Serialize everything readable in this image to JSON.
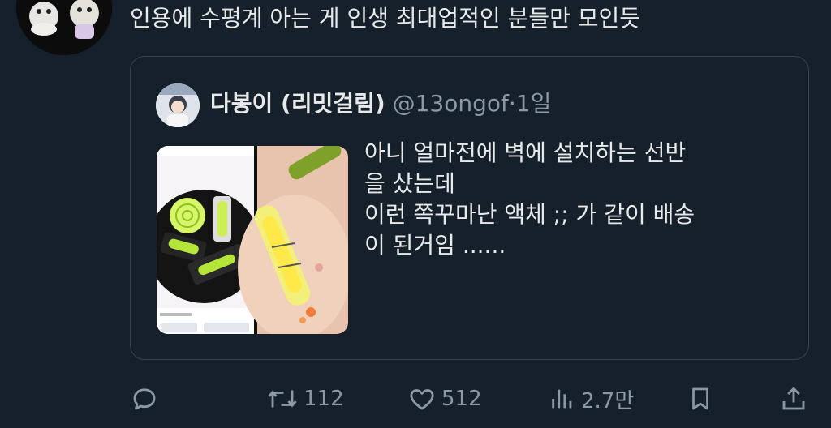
{
  "tweet": {
    "text": "인용에 수평계 아는 게 인생 최대업적인 분들만 모인듯"
  },
  "quote": {
    "name": "다봉이 (리밋걸림)",
    "handle": "@13ongof",
    "separator": "·",
    "time": "1일",
    "lines": [
      "아니 얼마전에 벽에 설치하는 선반",
      "을 샀는데",
      "이런 쪽꾸마난 액체 ;; 가 같이 배송",
      "이 된거임 ......"
    ]
  },
  "actions": {
    "reply": {
      "icon": "reply-icon"
    },
    "retweet": {
      "icon": "retweet-icon",
      "count": "112"
    },
    "like": {
      "icon": "heart-icon",
      "count": "512"
    },
    "views": {
      "icon": "views-icon",
      "count": "2.7만"
    },
    "bookmark": {
      "icon": "bookmark-icon"
    },
    "share": {
      "icon": "share-icon"
    }
  },
  "colors": {
    "background": "#15202b",
    "text": "#e7e9ea",
    "muted": "#8b98a5",
    "border": "#38444d"
  }
}
